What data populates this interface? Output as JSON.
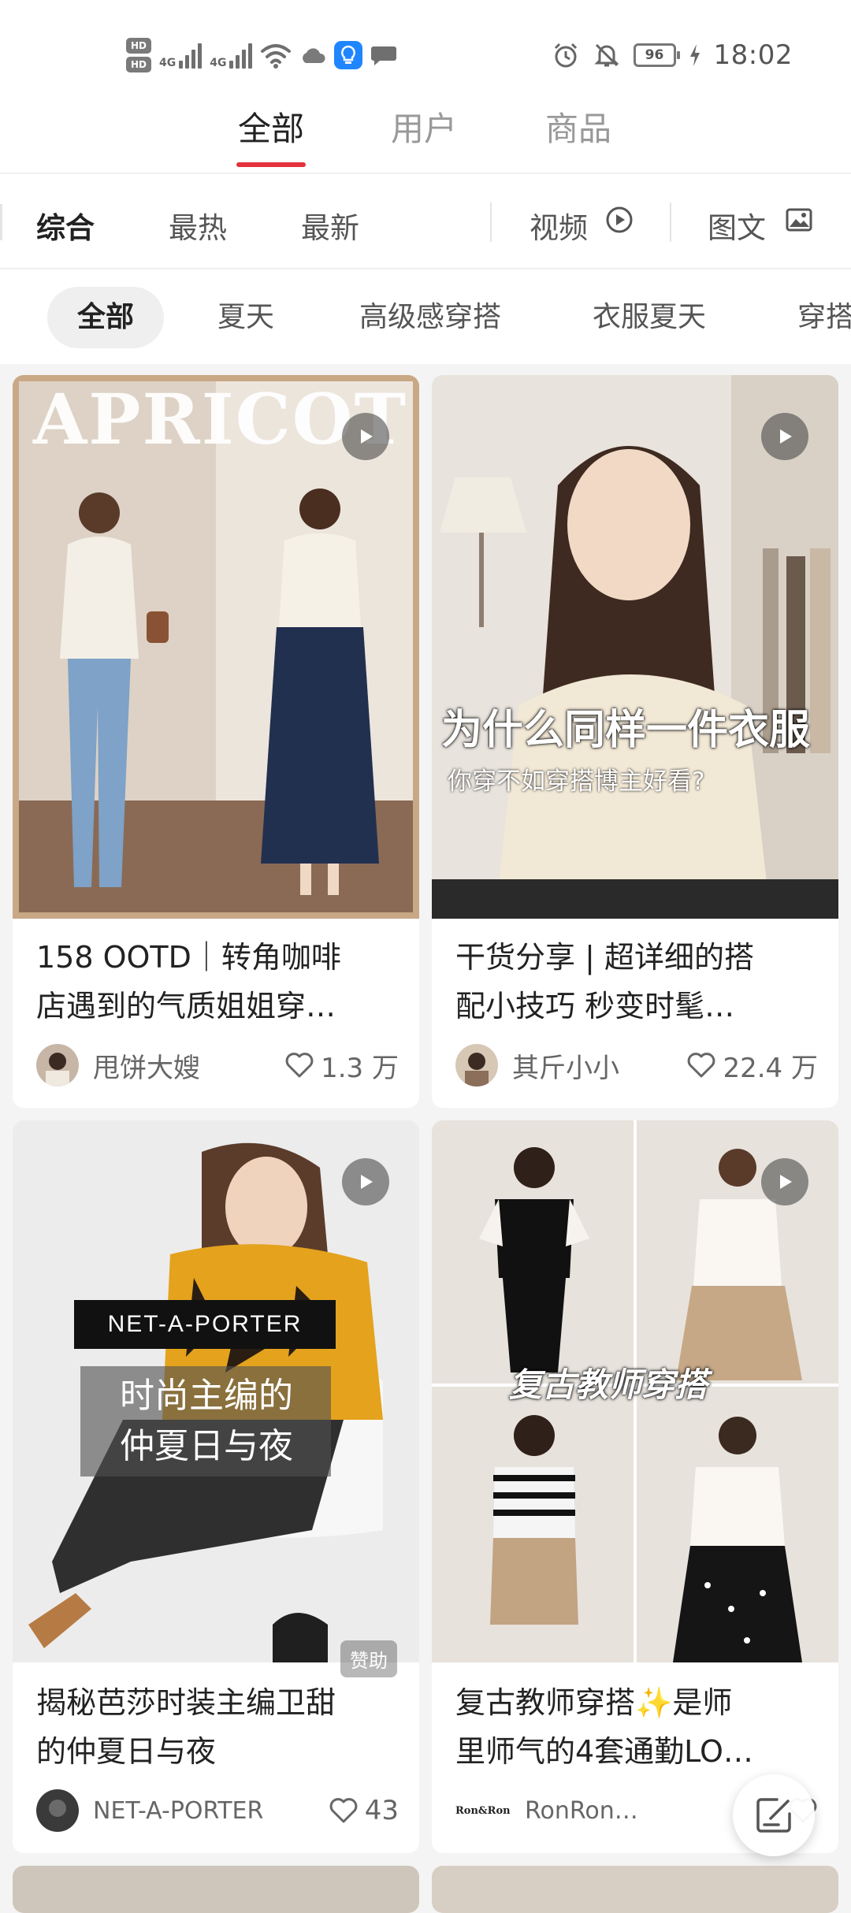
{
  "status_bar": {
    "hd1": "HD",
    "hd2": "HD",
    "net1": "4G",
    "net2": "4G",
    "battery": "96",
    "time": "18:02"
  },
  "top_tabs": [
    {
      "label": "全部",
      "active": true
    },
    {
      "label": "用户",
      "active": false
    },
    {
      "label": "商品",
      "active": false
    }
  ],
  "filters": {
    "sort": [
      "综合",
      "最热",
      "最新"
    ],
    "video_label": "视频",
    "image_text_label": "图文"
  },
  "chips": [
    "全部",
    "夏天",
    "高级感穿搭",
    "衣服夏天",
    "穿搭"
  ],
  "feed": [
    {
      "overlay_title": "APRICOT",
      "title_line1": "158 OOTD｜转角咖啡",
      "title_line2": "店遇到的气质姐姐穿…",
      "author": "甩饼大嫂",
      "likes": "1.3 万",
      "is_video": true
    },
    {
      "overlay_title": "为什么同样一件衣服",
      "overlay_sub": "你穿不如穿搭博主好看?",
      "title_line1": "干货分享 | 超详细的搭",
      "title_line2": "配小技巧 秒变时髦…",
      "author": "其斤小小",
      "likes": "22.4 万",
      "is_video": true
    },
    {
      "brand_banner": "NET-A-PORTER",
      "overlay_title": "时尚主编的\n仲夏日与夜",
      "title_line1": "揭秘芭莎时装主编卫甜",
      "title_line2": "的仲夏日与夜",
      "author": "NET-A-PORTER",
      "likes": "43",
      "sponsor": "赞助",
      "is_video": true
    },
    {
      "overlay_title": "复古教师穿搭",
      "title_line1": "复古教师穿搭✨是师",
      "title_line2": "里师气的4套通勤LO…",
      "author": "RonRon…",
      "avatar_text": "Ron&Ron",
      "is_video": true
    }
  ],
  "colors": {
    "accent": "#e2323d",
    "page_bg": "#f4f4f4"
  }
}
